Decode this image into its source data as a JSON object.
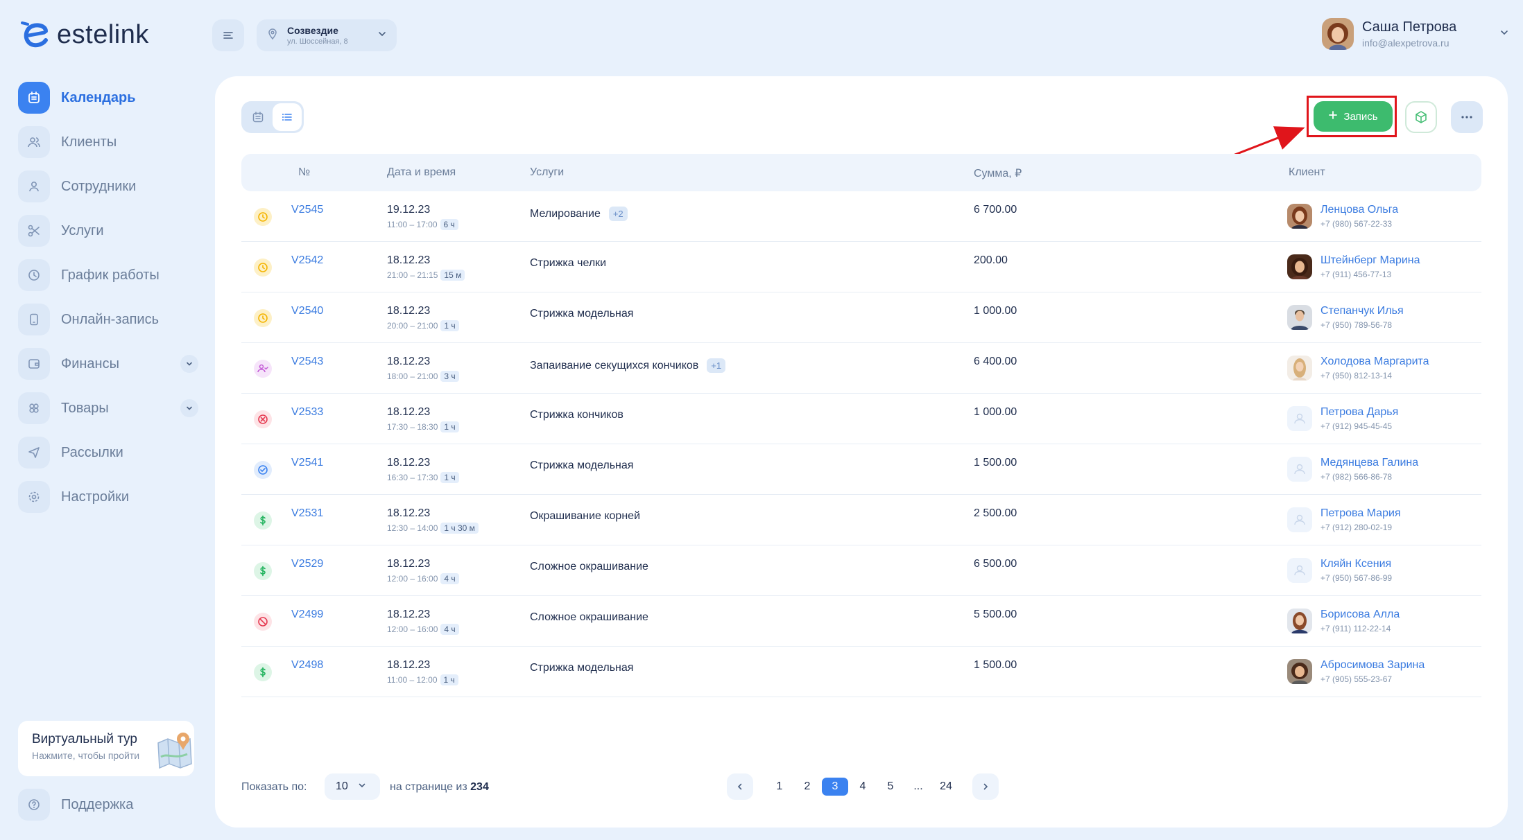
{
  "brand": {
    "name": "estelink"
  },
  "sidebar": {
    "items": [
      {
        "label": "Календарь",
        "icon": "calendar-icon",
        "active": true
      },
      {
        "label": "Клиенты",
        "icon": "users-icon"
      },
      {
        "label": "Сотрудники",
        "icon": "user-icon"
      },
      {
        "label": "Услуги",
        "icon": "scissors-icon"
      },
      {
        "label": "График работы",
        "icon": "clock-icon"
      },
      {
        "label": "Онлайн-запись",
        "icon": "phone-icon"
      },
      {
        "label": "Финансы",
        "icon": "wallet-icon",
        "expandable": true
      },
      {
        "label": "Товары",
        "icon": "products-icon",
        "expandable": true
      },
      {
        "label": "Рассылки",
        "icon": "send-icon"
      },
      {
        "label": "Настройки",
        "icon": "gear-icon"
      }
    ],
    "tour": {
      "title": "Виртуальный тур",
      "subtitle": "Нажмите, чтобы пройти"
    },
    "support": "Поддержка"
  },
  "header": {
    "location": {
      "name": "Созвездие",
      "address": "ул. Шоссейная, 8"
    },
    "user": {
      "name": "Саша Петрова",
      "email": "info@alexpetrova.ru"
    }
  },
  "toolbar": {
    "add_label": "Запись"
  },
  "table": {
    "headers": {
      "num": "№",
      "date": "Дата и время",
      "services": "Услуги",
      "sum": "Сумма, ₽",
      "client": "Клиент"
    },
    "rows": [
      {
        "status": "pending",
        "num": "V2545",
        "date": "19.12.23",
        "time": "11:00 – 17:00",
        "dur": "6 ч",
        "service": "Мелирование",
        "extra": "+2",
        "sum": "6 700.00",
        "client": "Ленцова Ольга",
        "phone": "+7 (980) 567-22-33",
        "avatar": "photo-a"
      },
      {
        "status": "pending",
        "num": "V2542",
        "date": "18.12.23",
        "time": "21:00 – 21:15",
        "dur": "15 м",
        "service": "Стрижка челки",
        "extra": "",
        "sum": "200.00",
        "client": "Штейнберг Марина",
        "phone": "+7 (911) 456-77-13",
        "avatar": "photo-b"
      },
      {
        "status": "pending",
        "num": "V2540",
        "date": "18.12.23",
        "time": "20:00 – 21:00",
        "dur": "1 ч",
        "service": "Стрижка модельная",
        "extra": "",
        "sum": "1 000.00",
        "client": "Степанчук Илья",
        "phone": "+7 (950) 789-56-78",
        "avatar": "photo-c"
      },
      {
        "status": "arrived",
        "num": "V2543",
        "date": "18.12.23",
        "time": "18:00 – 21:00",
        "dur": "3 ч",
        "service": "Запаивание секущихся кончиков",
        "extra": "+1",
        "sum": "6 400.00",
        "client": "Холодова Маргарита",
        "phone": "+7 (950) 812-13-14",
        "avatar": "photo-d"
      },
      {
        "status": "cancelled",
        "num": "V2533",
        "date": "18.12.23",
        "time": "17:30 – 18:30",
        "dur": "1 ч",
        "service": "Стрижка кончиков",
        "extra": "",
        "sum": "1 000.00",
        "client": "Петрова Дарья",
        "phone": "+7 (912) 945-45-45",
        "avatar": "none"
      },
      {
        "status": "confirmed",
        "num": "V2541",
        "date": "18.12.23",
        "time": "16:30 – 17:30",
        "dur": "1 ч",
        "service": "Стрижка модельная",
        "extra": "",
        "sum": "1 500.00",
        "client": "Медянцева Галина",
        "phone": "+7 (982) 566-86-78",
        "avatar": "none"
      },
      {
        "status": "paid",
        "num": "V2531",
        "date": "18.12.23",
        "time": "12:30 – 14:00",
        "dur": "1 ч 30 м",
        "service": "Окрашивание корней",
        "extra": "",
        "sum": "2 500.00",
        "client": "Петрова Мария",
        "phone": "+7 (912) 280-02-19",
        "avatar": "none"
      },
      {
        "status": "paid",
        "num": "V2529",
        "date": "18.12.23",
        "time": "12:00 – 16:00",
        "dur": "4 ч",
        "service": "Сложное окрашивание",
        "extra": "",
        "sum": "6 500.00",
        "client": "Кляйн Ксения",
        "phone": "+7 (950) 567-86-99",
        "avatar": "none"
      },
      {
        "status": "noshow",
        "num": "V2499",
        "date": "18.12.23",
        "time": "12:00 – 16:00",
        "dur": "4 ч",
        "service": "Сложное окрашивание",
        "extra": "",
        "sum": "5 500.00",
        "client": "Борисова Алла",
        "phone": "+7 (911) 112-22-14",
        "avatar": "photo-e"
      },
      {
        "status": "paid",
        "num": "V2498",
        "date": "18.12.23",
        "time": "11:00 – 12:00",
        "dur": "1 ч",
        "service": "Стрижка модельная",
        "extra": "",
        "sum": "1 500.00",
        "client": "Абросимова Зарина",
        "phone": "+7 (905) 555-23-67",
        "avatar": "photo-f"
      }
    ]
  },
  "footer": {
    "show_label": "Показать по:",
    "per_page": "10",
    "of_label": "на странице из",
    "total": "234",
    "pages": [
      "1",
      "2",
      "3",
      "4",
      "5",
      "...",
      "24"
    ],
    "current_page": "3"
  },
  "colors": {
    "accent": "#3b82f0",
    "add_button": "#3dbb6e",
    "highlight": "#e0151b",
    "pending": "#f4b400",
    "arrived": "#c45cd6",
    "cancelled": "#e53950",
    "confirmed": "#3b82f0",
    "paid": "#22b35e"
  }
}
